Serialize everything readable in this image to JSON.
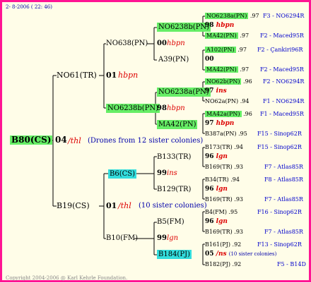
{
  "header": {
    "timestamp": "2-  8-2006 ( 22: 46)"
  },
  "footer": {
    "copyright": "Copyright 2004-2006 @ Karl Kehrle Foundation."
  },
  "root": {
    "id": "B80(CS)",
    "score": "04",
    "mark": "/thl",
    "note": "(Drones from 12 sister colonies)"
  },
  "gen1": [
    {
      "id": "NO61(TR)",
      "score": "01",
      "mark": "hbpn"
    },
    {
      "id": "B19(CS)",
      "score": "01",
      "mark": "/thl",
      "note": "(10 sister colonies)"
    }
  ],
  "gen2": [
    {
      "id": "NO638(PN)",
      "score": "00",
      "mark": "hbpn"
    },
    {
      "id": "NO6238b(PN)",
      "score": "98",
      "mark": "hbpn"
    },
    {
      "id": "B6(CS)",
      "score": "99",
      "mark": "ins"
    },
    {
      "id": "B10(FM)",
      "score": "99",
      "mark": "lgn"
    }
  ],
  "gen3": [
    {
      "id": "NO6238b(PN)",
      "score": "98",
      "mark": "hbpn"
    },
    {
      "id": "A39(PN)"
    },
    {
      "id": "NO6238a(PN)",
      "score": "97",
      "mark": "ins"
    },
    {
      "id": "MA42(PN)",
      "score": "97",
      "mark": "hbpn"
    },
    {
      "id": "B133(TR)",
      "score": "96",
      "mark": "lgn"
    },
    {
      "id": "B129(TR)",
      "score": "96",
      "mark": "lgn"
    },
    {
      "id": "B5(FM)",
      "score": "96",
      "mark": "lgn"
    },
    {
      "id": "B184(PJ)",
      "score": "05",
      "mark": "/ns",
      "note": "(10 sister colonies)"
    }
  ],
  "gen4": [
    {
      "id": "NO6238a(PN)",
      "score": ".97",
      "src": "F3 - NO6294R"
    },
    {
      "id": "MA42(PN)",
      "score": ".97",
      "src": "F2 - Maced95R"
    },
    {
      "id": "A102(PN)",
      "score": ".97",
      "src": "F2 - Çankiri96R"
    },
    {
      "id": "MA42(PN)",
      "score": ".97",
      "src": "F2 - Maced95R"
    },
    {
      "id": "NO62b(PN)",
      "score": ".96",
      "src": "F2 - NO6294R"
    },
    {
      "id": "NO62a(PN)",
      "score": ".94",
      "src": "F1 - NO6294R"
    },
    {
      "id": "MA42a(PN)",
      "score": ".96",
      "src": "F1 - Maced95R"
    },
    {
      "id": "B387a(PN)",
      "score": ".95",
      "src": "F15 - Sinop62R"
    },
    {
      "id": "B173(TR)",
      "score": ".94",
      "src": "F15 - Sinop62R"
    },
    {
      "id": "B169(TR)",
      "score": ".93",
      "src": "F7 - Atlas85R"
    },
    {
      "id": "B34(TR)",
      "score": ".94",
      "src": "F8 - Atlas85R"
    },
    {
      "id": "B169(TR)",
      "score": ".93",
      "src": "F7 - Atlas85R"
    },
    {
      "id": "B4(FM)",
      "score": ".95",
      "src": "F16 - Sinop62R"
    },
    {
      "id": "B169(TR)",
      "score": ".93",
      "src": "F7 - Atlas85R"
    },
    {
      "id": "B161(PJ)",
      "score": ".92",
      "src": "F13 - Sinop62R"
    },
    {
      "id": "B182(PJ)",
      "score": ".92",
      "src": "F5 - B14D"
    }
  ],
  "colors": {
    "frame": "#ff1493",
    "background": "#fffde8",
    "highlight_green": "#66ee66",
    "highlight_cyan": "#33dddd",
    "mark_red": "#dd0000",
    "source_blue": "#0000cc"
  }
}
